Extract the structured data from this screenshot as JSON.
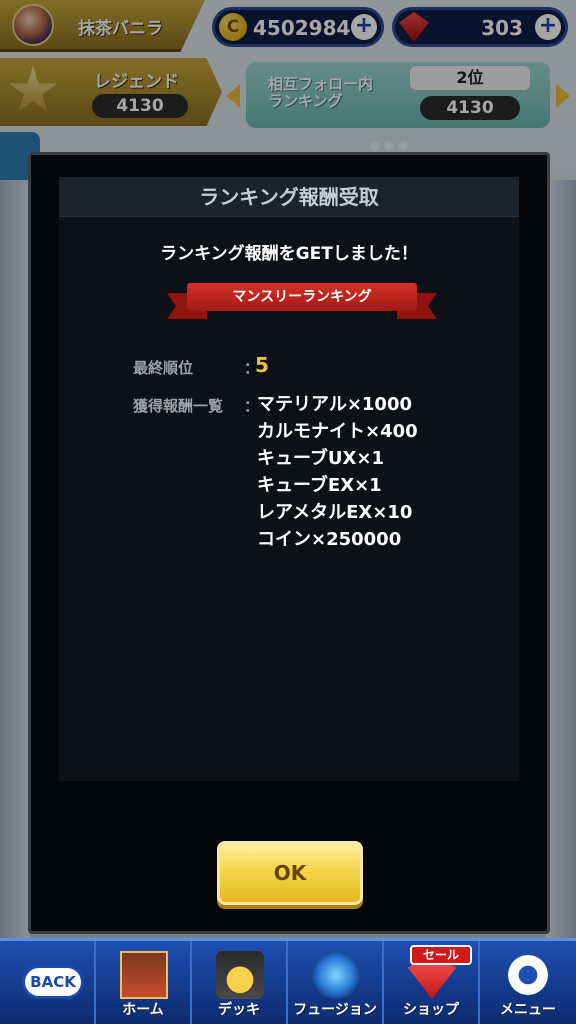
{
  "colors": {
    "gold": "#c8a93c",
    "accent_blue": "#1e4fb3",
    "ribbon_red": "#d6302a",
    "rank_yellow": "#f0c23e",
    "ok_button": "#f5d64a"
  },
  "header": {
    "player_name": "抹茶バニラ",
    "coins": {
      "icon": "coin-icon",
      "symbol": "C",
      "value": "4502984",
      "plus": "+"
    },
    "gems": {
      "icon": "red-gem-icon",
      "value": "303",
      "plus": "+"
    }
  },
  "rank_bar": {
    "legend_label": "レジェンド",
    "legend_score": "4130",
    "follow_label_line1": "相互フォロー内",
    "follow_label_line2": "ランキング",
    "follow_rank": "2位",
    "follow_score": "4130"
  },
  "modal": {
    "title": "ランキング報酬受取",
    "message": "ランキング報酬をGETしました！",
    "ribbon": "マンスリーランキング",
    "final_rank_label": "最終順位",
    "separator": "：",
    "final_rank_value": "5",
    "rewards_label": "獲得報酬一覧",
    "rewards": [
      "マテリアル×1000",
      "カルモナイト×400",
      "キューブUX×1",
      "キューブEX×1",
      "レアメタルEX×10",
      "コイン×250000"
    ],
    "ok_label": "OK"
  },
  "nav": {
    "back": "BACK",
    "home": "ホーム",
    "deck": "デッキ",
    "fusion": "フュージョン",
    "shop": "ショップ",
    "sale": "セール",
    "menu": "メニュー"
  }
}
